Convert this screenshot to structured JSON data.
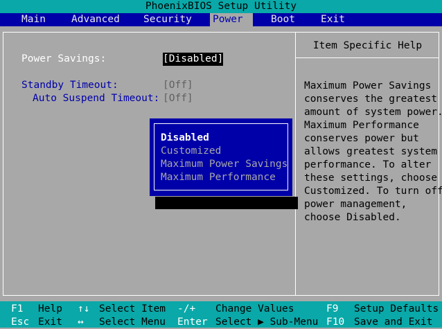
{
  "app_title": "PhoenixBIOS Setup Utility",
  "menu": [
    {
      "label": "Main",
      "active": false
    },
    {
      "label": "Advanced",
      "active": false
    },
    {
      "label": "Security",
      "active": false
    },
    {
      "label": "Power",
      "active": true
    },
    {
      "label": "Boot",
      "active": false
    },
    {
      "label": "Exit",
      "active": false
    }
  ],
  "settings": {
    "power_savings": {
      "label": "Power Savings:",
      "value": "[Disabled]"
    },
    "standby_timeout": {
      "label": "Standby Timeout:",
      "value": "[Off]"
    },
    "auto_suspend_timeout": {
      "label": "Auto Suspend Timeout:",
      "value": "[Off]"
    }
  },
  "popup": {
    "options": [
      "Disabled",
      "Customized",
      "Maximum Power Savings",
      "Maximum Performance"
    ],
    "selected": "Disabled"
  },
  "help": {
    "title": "Item Specific Help",
    "text": "Maximum Power Savings\nconserves the greatest\namount of system power.\nMaximum Performance\nconserves power but\nallows greatest system\nperformance. To alter\nthese settings, choose\nCustomized. To turn off\npower management,\nchoose Disabled."
  },
  "keybar": {
    "row1": [
      {
        "key": "F1",
        "desc": "Help"
      },
      {
        "key": "↑↓",
        "desc": "Select Item"
      },
      {
        "key": "-/+",
        "desc": "Change Values"
      },
      {
        "key": "F9",
        "desc": "Setup Defaults"
      }
    ],
    "row2": [
      {
        "key": "Esc",
        "desc": "Exit"
      },
      {
        "key": "↔",
        "desc": "Select Menu"
      },
      {
        "key": "Enter",
        "desc": "Select ▶ Sub-Menu"
      },
      {
        "key": "F10",
        "desc": "Save and Exit"
      }
    ]
  },
  "colors": {
    "background": "#a8a8a8",
    "menubar": "#0000a8",
    "titlebar": "#0aa8a8",
    "popup": "#0000a8"
  }
}
